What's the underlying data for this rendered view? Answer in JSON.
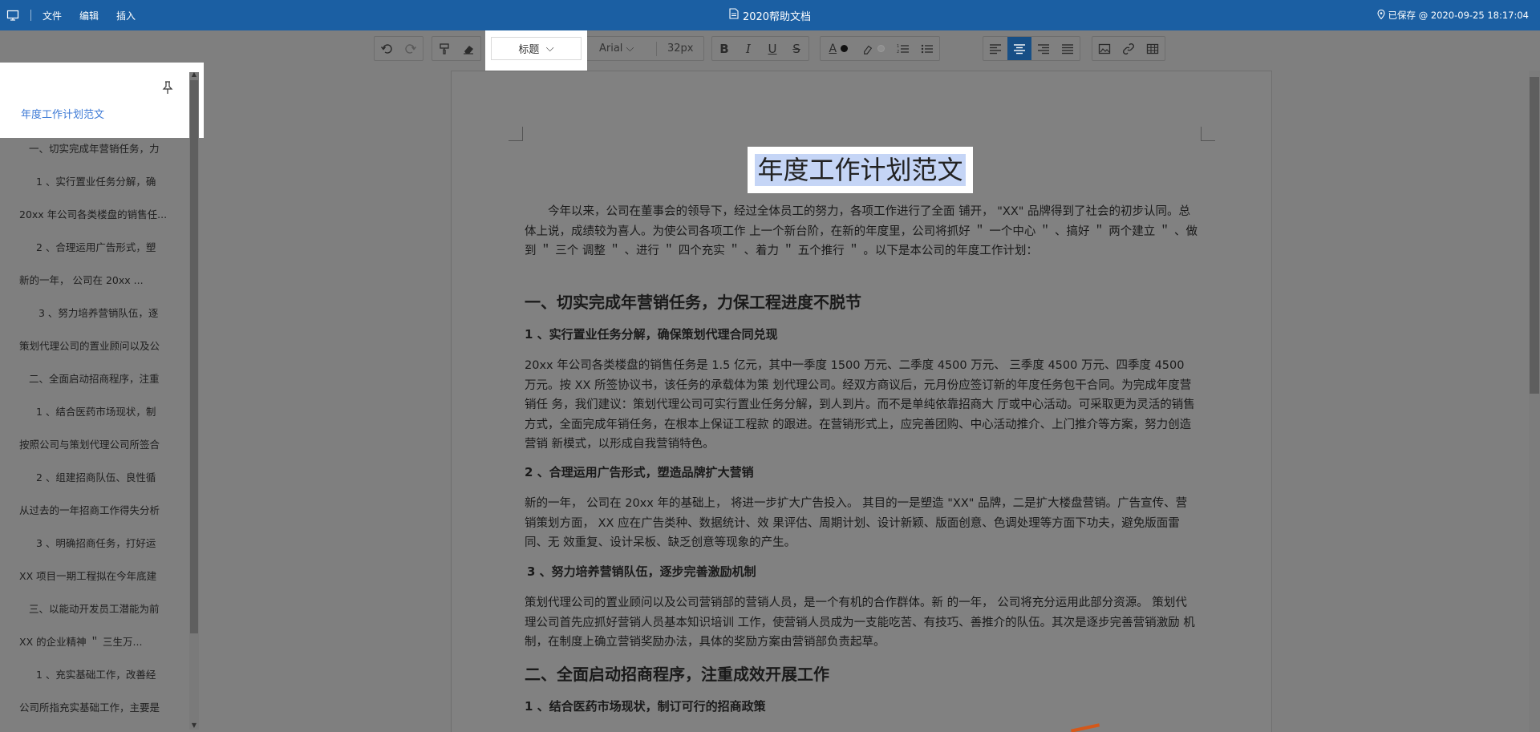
{
  "topbar": {
    "menus": [
      "文件",
      "编辑",
      "插入"
    ],
    "title": "2020帮助文档",
    "save_status": "已保存 @ 2020-09-25 18:17:04"
  },
  "toolbar": {
    "style_select": "标题",
    "font_select": "Arial",
    "font_size": "32px",
    "icons": [
      "undo-icon",
      "redo-icon",
      "format-painter-icon",
      "eraser-icon",
      "bold-icon",
      "italic-icon",
      "underline-icon",
      "strikethrough-icon",
      "font-color-icon",
      "highlight-icon",
      "ordered-list-icon",
      "unordered-list-icon",
      "align-left-icon",
      "align-center-icon",
      "align-right-icon",
      "justify-icon",
      "image-icon",
      "link-icon",
      "table-icon"
    ],
    "active_alignment": "center"
  },
  "outline": {
    "top_item": "年度工作计划范文",
    "items": [
      "一、切实完成年营销任务，力",
      "1 、实行置业任务分解，确",
      "20xx  年公司各类楼盘的销售任...",
      "2 、合理运用广告形式，塑",
      "新的一年，  公司在  20xx ...",
      "3 、努力培养营销队伍，逐",
      "策划代理公司的置业顾问以及公",
      "二、全面启动招商程序，注重",
      "1 、结合医药市场现状，制",
      "按照公司与策划代理公司所签合",
      "2 、组建招商队伍、良性循",
      "从过去的一年招商工作得失分析",
      "3 、明确招商任务，打好运",
      "XX  项目一期工程拟在今年底建",
      "三、以能动开发员工潜能为前",
      "XX  的企业精神 ＂ 三生万...",
      "1 、充实基础工作，改善经",
      "公司所指充实基础工作，主要是"
    ]
  },
  "document": {
    "title": "年度工作计划范文",
    "intro": "今年以来，公司在董事会的领导下，经过全体员工的努力，各项工作进行了全面  铺开，  \"XX\" 品牌得到了社会的初步认同。总体上说，成绩较为喜人。为使公司各项工作  上一个新台阶，在新的年度里，公司将抓好 ＂ 一个中心 ＂ 、搞好 ＂ 两个建立 ＂ 、做到 ＂ 三个  调整 ＂ 、进行 ＂ 四个充实 ＂ 、着力 ＂ 五个推行 ＂ 。以下是本公司的年度工作计划：",
    "h1_1": "一、切实完成年营销任务，力保工程进度不脱节",
    "h2_1": "1 、实行置业任务分解，确保策划代理合同兑现",
    "p1": "20xx  年公司各类楼盘的销售任务是  1.5  亿元，其中一季度  1500  万元、二季度  4500  万元、  三季度  4500  万元、四季度  4500  万元。按    XX  所签协议书，该任务的承载体为策  划代理公司。经双方商议后，元月份应签订新的年度任务包干合同。为完成年度营销任  务，我们建议：策划代理公司可实行置业任务分解，到人到片。而不是单纯依靠招商大  厅或中心活动。可采取更为灵活的销售方式，全面完成年销任务，在根本上保证工程款  的跟进。在营销形式上，应完善团购、中心活动推介、上门推介等方案，努力创造营销  新模式，以形成自我营销特色。",
    "h2_2": "2 、合理运用广告形式，塑造品牌扩大营销",
    "p2": "新的一年，  公司在  20xx  年的基础上，  将进一步扩大广告投入。  其目的一是塑造  \"XX\"  品牌，二是扩大楼盘营销。广告宣传、营销策划方面，  XX  应在广告类种、数据统计、效  果评估、周期计划、设计新颖、版面创意、色调处理等方面下功夫，避免版面雷同、无  效重复、设计呆板、缺乏创意等现象的产生。",
    "h2_3": "3 、努力培养营销队伍，逐步完善激励机制",
    "p3": "策划代理公司的置业顾问以及公司营销部的营销人员，是一个有机的合作群体。新  的一年，  公司将充分运用此部分资源。  策划代理公司首先应抓好营销人员基本知识培训  工作，使营销人员成为一支能吃苦、有技巧、善推介的队伍。其次是逐步完善营销激励  机制，在制度上确立营销奖励办法，具体的奖励方案由营销部负责起草。",
    "h1_2": "二、全面启动招商程序，注重成效开展工作",
    "h2_4": "1 、结合医药市场现状，制订可行的招商政策"
  }
}
